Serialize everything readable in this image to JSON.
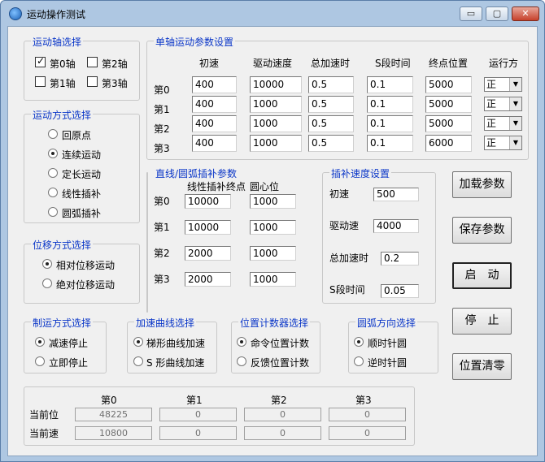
{
  "window": {
    "title": "运动操作测试",
    "buttons": [
      "▭",
      "▢",
      "✕"
    ]
  },
  "axis_select": {
    "legend": "运动轴选择",
    "items": [
      {
        "label": "第0轴",
        "checked": true
      },
      {
        "label": "第2轴",
        "checked": false
      },
      {
        "label": "第1轴",
        "checked": false
      },
      {
        "label": "第3轴",
        "checked": false
      }
    ]
  },
  "motion_mode": {
    "legend": "运动方式选择",
    "items": [
      {
        "label": "回原点",
        "checked": false
      },
      {
        "label": "连续运动",
        "checked": true
      },
      {
        "label": "定长运动",
        "checked": false
      },
      {
        "label": "线性插补",
        "checked": false
      },
      {
        "label": "圆弧插补",
        "checked": false
      }
    ]
  },
  "displacement_mode": {
    "legend": "位移方式选择",
    "items": [
      {
        "label": "相对位移运动",
        "checked": true
      },
      {
        "label": "绝对位移运动",
        "checked": false
      }
    ]
  },
  "single_axis": {
    "legend": "单轴运动参数设置",
    "headers": [
      "初速",
      "驱动速度",
      "总加速时",
      "S段时间",
      "终点位置",
      "运行方"
    ],
    "rows": [
      {
        "label": "第0",
        "values": [
          "400",
          "10000",
          "0.5",
          "0.1",
          "5000"
        ],
        "dir": "正"
      },
      {
        "label": "第1",
        "values": [
          "400",
          "1000",
          "0.5",
          "0.1",
          "5000"
        ],
        "dir": "正"
      },
      {
        "label": "第2",
        "values": [
          "400",
          "1000",
          "0.5",
          "0.1",
          "5000"
        ],
        "dir": "正"
      },
      {
        "label": "第3",
        "values": [
          "400",
          "1000",
          "0.5",
          "0.1",
          "6000"
        ],
        "dir": "正"
      }
    ]
  },
  "interp_params": {
    "legend": "直线/圆弧插补参数",
    "headers": [
      "线性插补终点",
      "圆心位"
    ],
    "rows": [
      {
        "label": "第0",
        "values": [
          "10000",
          "1000"
        ]
      },
      {
        "label": "第1",
        "values": [
          "10000",
          "1000"
        ]
      },
      {
        "label": "第2",
        "values": [
          "2000",
          "1000"
        ]
      },
      {
        "label": "第3",
        "values": [
          "2000",
          "1000"
        ]
      }
    ]
  },
  "interp_speed": {
    "legend": "插补速度设置",
    "fields": [
      {
        "label": "初速",
        "value": "500"
      },
      {
        "label": "驱动速",
        "value": "4000"
      },
      {
        "label": "总加速时",
        "value": "0.2"
      },
      {
        "label": "S段时间",
        "value": "0.05"
      }
    ]
  },
  "buttons": {
    "load": "加载参数",
    "save": "保存参数",
    "start": "启　动",
    "stop": "停　止",
    "clear": "位置清零"
  },
  "stop_mode": {
    "legend": "制运方式选择",
    "items": [
      {
        "label": "减速停止",
        "checked": true
      },
      {
        "label": "立即停止",
        "checked": false
      }
    ]
  },
  "accel_curve": {
    "legend": "加速曲线选择",
    "items": [
      {
        "label": "梯形曲线加速",
        "checked": true
      },
      {
        "label": "S 形曲线加速",
        "checked": false
      }
    ]
  },
  "pos_counter": {
    "legend": "位置计数器选择",
    "items": [
      {
        "label": "命令位置计数",
        "checked": true
      },
      {
        "label": "反馈位置计数",
        "checked": false
      }
    ]
  },
  "arc_dir": {
    "legend": "圆弧方向选择",
    "items": [
      {
        "label": "顺时针圆",
        "checked": true
      },
      {
        "label": "逆时针圆",
        "checked": false
      }
    ]
  },
  "status": {
    "headers": [
      "第0",
      "第1",
      "第2",
      "第3"
    ],
    "pos_label": "当前位",
    "speed_label": "当前速",
    "pos": [
      "48225",
      "0",
      "0",
      "0"
    ],
    "speed": [
      "10800",
      "0",
      "0",
      "0"
    ]
  }
}
